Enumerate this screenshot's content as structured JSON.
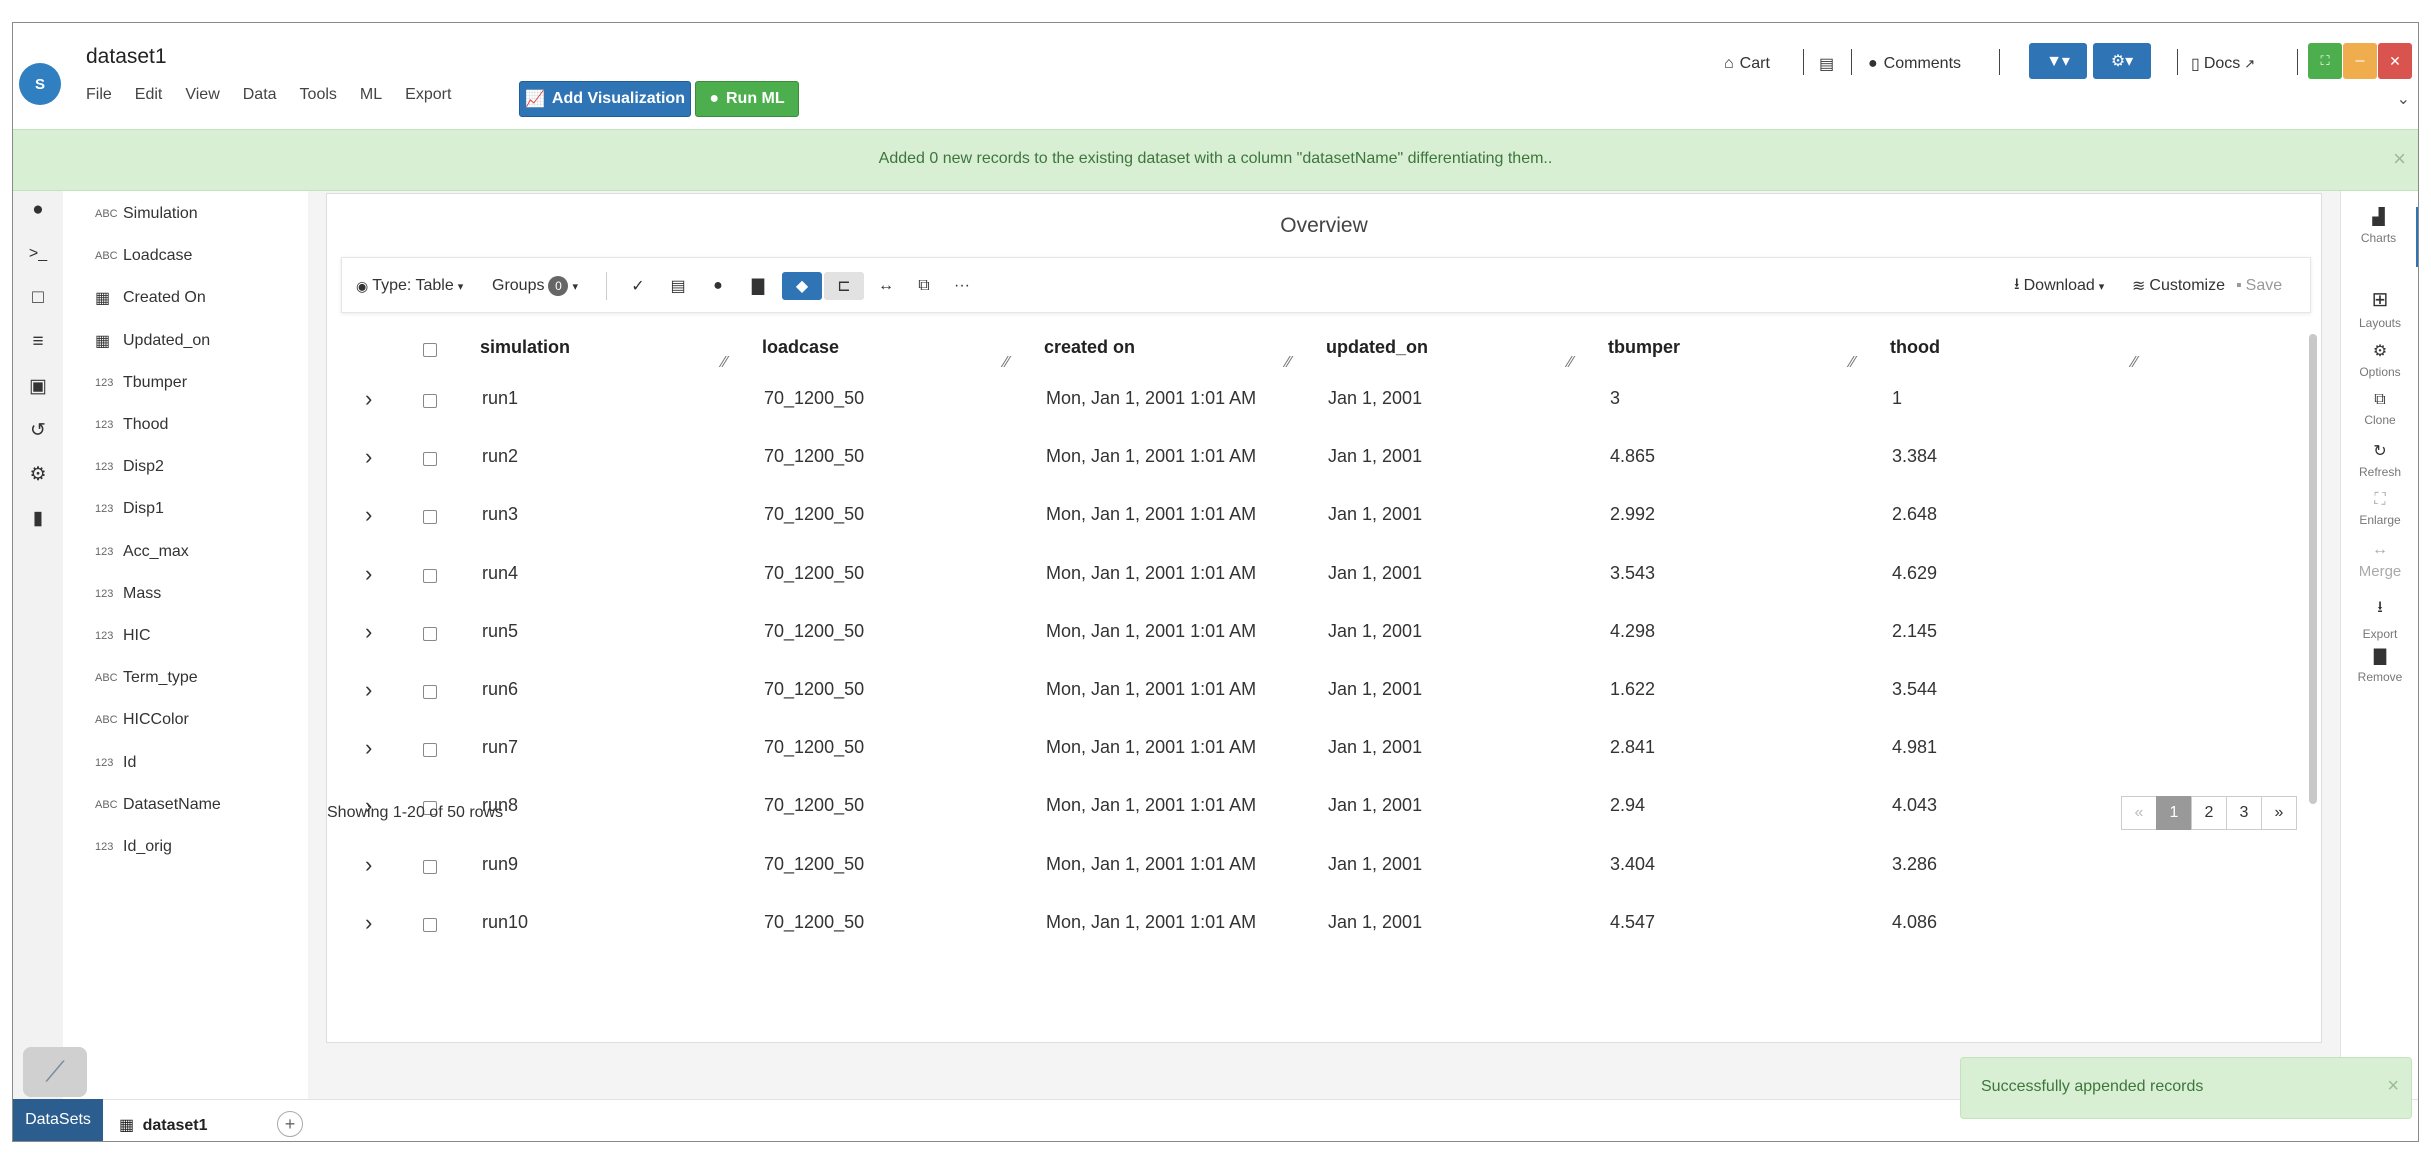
{
  "app": {
    "dataset_name": "dataset1",
    "logo_text": "S"
  },
  "menu": [
    "File",
    "Edit",
    "View",
    "Data",
    "Tools",
    "ML",
    "Export"
  ],
  "actions": {
    "add_visualization": "Add Visualization",
    "run_ml": "Run ML"
  },
  "header_right": {
    "cart": "Cart",
    "comments": "Comments",
    "docs": "Docs"
  },
  "banner": {
    "message": "Added 0 new records to the existing dataset with a column \"datasetName\" differentiating them.."
  },
  "fields": [
    {
      "type": "ABC",
      "name": "Simulation"
    },
    {
      "type": "ABC",
      "name": "Loadcase"
    },
    {
      "type": "table",
      "name": "Created On"
    },
    {
      "type": "table",
      "name": "Updated_on"
    },
    {
      "type": "123",
      "name": "Tbumper"
    },
    {
      "type": "123",
      "name": "Thood"
    },
    {
      "type": "123",
      "name": "Disp2"
    },
    {
      "type": "123",
      "name": "Disp1"
    },
    {
      "type": "123",
      "name": "Acc_max"
    },
    {
      "type": "123",
      "name": "Mass"
    },
    {
      "type": "123",
      "name": "HIC"
    },
    {
      "type": "ABC",
      "name": "Term_type"
    },
    {
      "type": "ABC",
      "name": "HICColor"
    },
    {
      "type": "123",
      "name": "Id"
    },
    {
      "type": "ABC",
      "name": "DatasetName"
    },
    {
      "type": "123",
      "name": "Id_orig"
    }
  ],
  "overview": {
    "title": "Overview",
    "toolbar": {
      "type_label": "Type: Table",
      "groups_label": "Groups",
      "groups_count": "0",
      "download": "Download",
      "customize": "Customize",
      "save": "Save"
    },
    "columns": [
      "simulation",
      "loadcase",
      "created on",
      "updated_on",
      "tbumper",
      "thood"
    ],
    "rows": [
      [
        "run1",
        "70_1200_50",
        "Mon, Jan 1, 2001 1:01 AM",
        "Jan 1, 2001",
        "3",
        "1"
      ],
      [
        "run2",
        "70_1200_50",
        "Mon, Jan 1, 2001 1:01 AM",
        "Jan 1, 2001",
        "4.865",
        "3.384"
      ],
      [
        "run3",
        "70_1200_50",
        "Mon, Jan 1, 2001 1:01 AM",
        "Jan 1, 2001",
        "2.992",
        "2.648"
      ],
      [
        "run4",
        "70_1200_50",
        "Mon, Jan 1, 2001 1:01 AM",
        "Jan 1, 2001",
        "3.543",
        "4.629"
      ],
      [
        "run5",
        "70_1200_50",
        "Mon, Jan 1, 2001 1:01 AM",
        "Jan 1, 2001",
        "4.298",
        "2.145"
      ],
      [
        "run6",
        "70_1200_50",
        "Mon, Jan 1, 2001 1:01 AM",
        "Jan 1, 2001",
        "1.622",
        "3.544"
      ],
      [
        "run7",
        "70_1200_50",
        "Mon, Jan 1, 2001 1:01 AM",
        "Jan 1, 2001",
        "2.841",
        "4.981"
      ],
      [
        "run8",
        "70_1200_50",
        "Mon, Jan 1, 2001 1:01 AM",
        "Jan 1, 2001",
        "2.94",
        "4.043"
      ],
      [
        "run9",
        "70_1200_50",
        "Mon, Jan 1, 2001 1:01 AM",
        "Jan 1, 2001",
        "3.404",
        "3.286"
      ],
      [
        "run10",
        "70_1200_50",
        "Mon, Jan 1, 2001 1:01 AM",
        "Jan 1, 2001",
        "4.547",
        "4.086"
      ]
    ],
    "footer": "Showing 1-20 of 50 rows",
    "pager": {
      "prev": "«",
      "pages": [
        "1",
        "2",
        "3"
      ],
      "current": "1",
      "next": "»"
    }
  },
  "right_panel": [
    "Charts",
    "Layouts",
    "Options",
    "Clone",
    "Refresh",
    "Enlarge",
    "Merge",
    "Export",
    "Remove"
  ],
  "bottom": {
    "datasets_tab": "DataSets",
    "open_tab": "dataset1"
  },
  "toast": {
    "message": "Successfully appended records"
  },
  "colors": {
    "primary": "#2f74b5",
    "success": "#4cae4c",
    "banner_bg": "#d9efd4",
    "banner_text": "#3c763d",
    "orange": "#f0ad4e",
    "danger": "#d9534f"
  }
}
